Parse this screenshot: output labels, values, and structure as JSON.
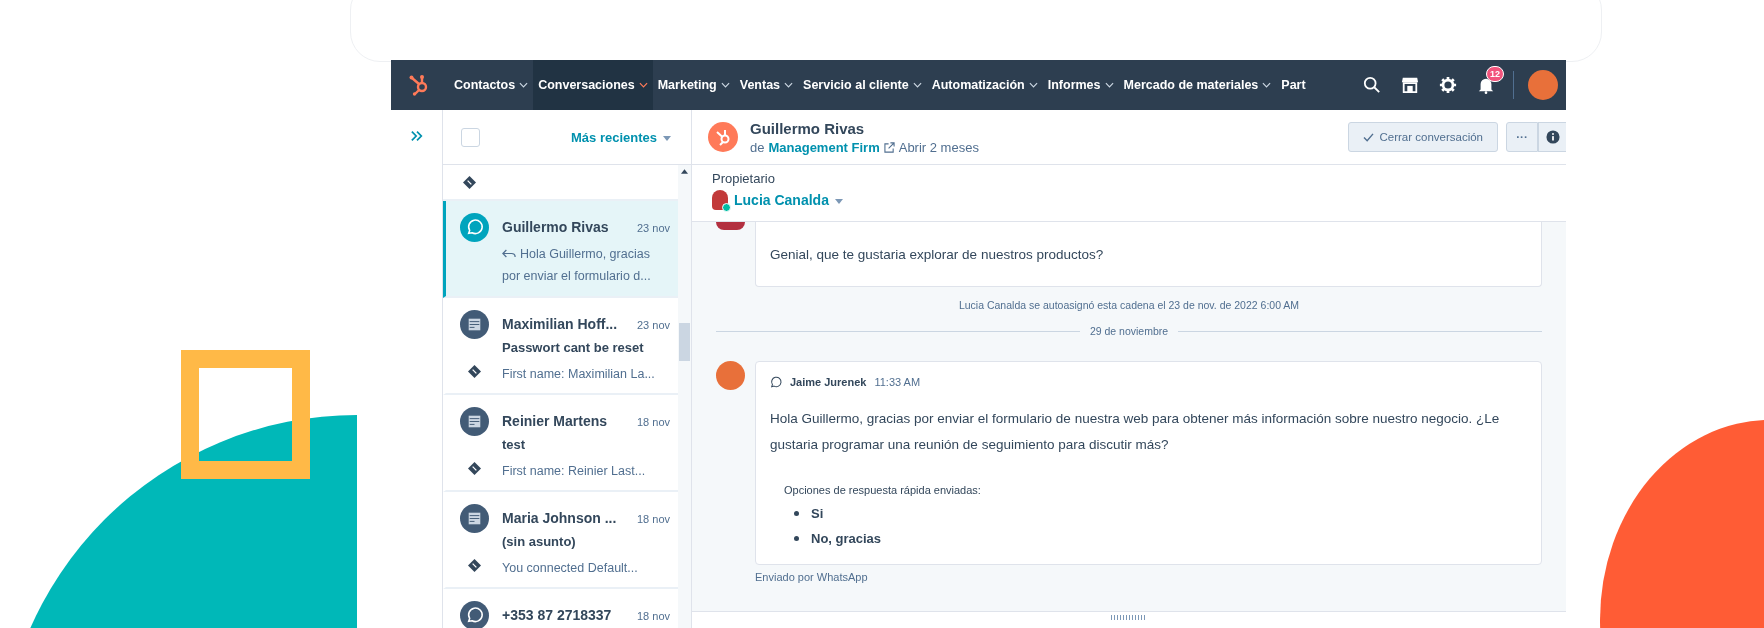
{
  "nav": {
    "items": [
      {
        "label": "Contactos",
        "selected": false
      },
      {
        "label": "Conversaciones",
        "selected": true
      },
      {
        "label": "Marketing",
        "selected": false
      },
      {
        "label": "Ventas",
        "selected": false
      },
      {
        "label": "Servicio al cliente",
        "selected": false
      },
      {
        "label": "Automatización",
        "selected": false
      },
      {
        "label": "Informes",
        "selected": false
      },
      {
        "label": "Mercado de materiales",
        "selected": false
      },
      {
        "label": "Part",
        "selected": false
      }
    ],
    "notification_count": "12"
  },
  "inbox": {
    "sort": "Más recientes",
    "select_all_checked": false,
    "conversations": [
      {
        "kind": "whatsapp",
        "name": "Guillermo Rivas",
        "date": "23 nov",
        "preview": "Hola Guillermo, gracias por enviar el formulario d...",
        "replied": true,
        "selected": true
      },
      {
        "kind": "form",
        "name": "Maximilian Hoff...",
        "date": "23 nov",
        "subject": "Passwort cant be reset",
        "preview": "First name: Maximilian La...",
        "replied": false,
        "selected": false
      },
      {
        "kind": "form",
        "name": "Reinier Martens",
        "date": "18 nov",
        "subject": "test",
        "preview": "First name: Reinier Last...",
        "replied": false,
        "selected": false
      },
      {
        "kind": "form",
        "name": "Maria Johnson ...",
        "date": "18 nov",
        "subject": "(sin asunto)",
        "preview": "You connected Default...",
        "replied": false,
        "selected": false
      },
      {
        "kind": "whatsapp",
        "name": "+353 87 2718337",
        "date": "18 nov",
        "selected": false
      }
    ]
  },
  "conversation": {
    "contact": "Guillermo Rivas",
    "from_prefix": "de",
    "company": "Management Firm",
    "opened": "Abrir 2 meses",
    "close_button": "Cerrar conversación",
    "more_button": "···",
    "owner_label": "Propietario",
    "owner": "Lucia Canalda",
    "thread": [
      {
        "kind": "message",
        "body": "Genial, que te gustaria explorar de nuestros productos?"
      },
      {
        "kind": "note",
        "text": "Lucia Canalda se autoasignó esta cadena el 23 de nov. de 2022 6:00 AM"
      },
      {
        "kind": "divider",
        "text": "29 de noviembre"
      },
      {
        "kind": "message",
        "author": "Jaime Jurenek",
        "time": "11:33 AM",
        "body": "Hola Guillermo, gracias por enviar el formulario de nuestra web para obtener más información sobre nuestro negocio. ¿Le gustaria programar una reunión de seguimiento para discutir más?",
        "quick_replies_label": "Opciones de respuesta rápida enviadas:",
        "quick_replies": [
          "Si",
          "No, gracias"
        ],
        "footer": "Enviado por WhatsApp"
      }
    ]
  }
}
